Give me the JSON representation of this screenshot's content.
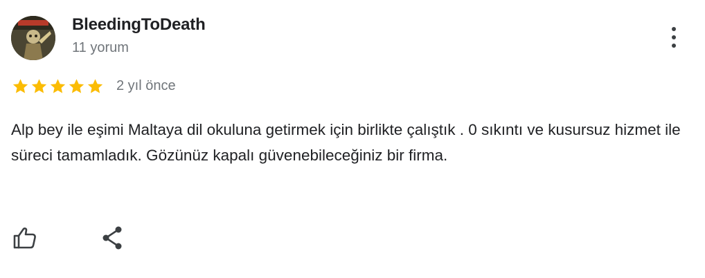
{
  "review": {
    "author_name": "BleedingToDeath",
    "review_count": "11 yorum",
    "rating": 5,
    "rating_max": 5,
    "date": "2 yıl önce",
    "text": "Alp bey ile eşimi Maltaya dil okuluna getirmek için birlikte çalıştık . 0 sıkıntı ve kusursuz hizmet ile süreci tamamladık. Gözünüz kapalı güvenebileceğiniz bir firma."
  },
  "icons": {
    "avatar": "avatar-image",
    "more": "more-vertical-icon",
    "star": "star-icon",
    "like": "thumbs-up-icon",
    "share": "share-icon"
  },
  "colors": {
    "star": "#fbbc04",
    "text": "#202124",
    "secondary": "#70757a",
    "icon": "#3c4043"
  }
}
